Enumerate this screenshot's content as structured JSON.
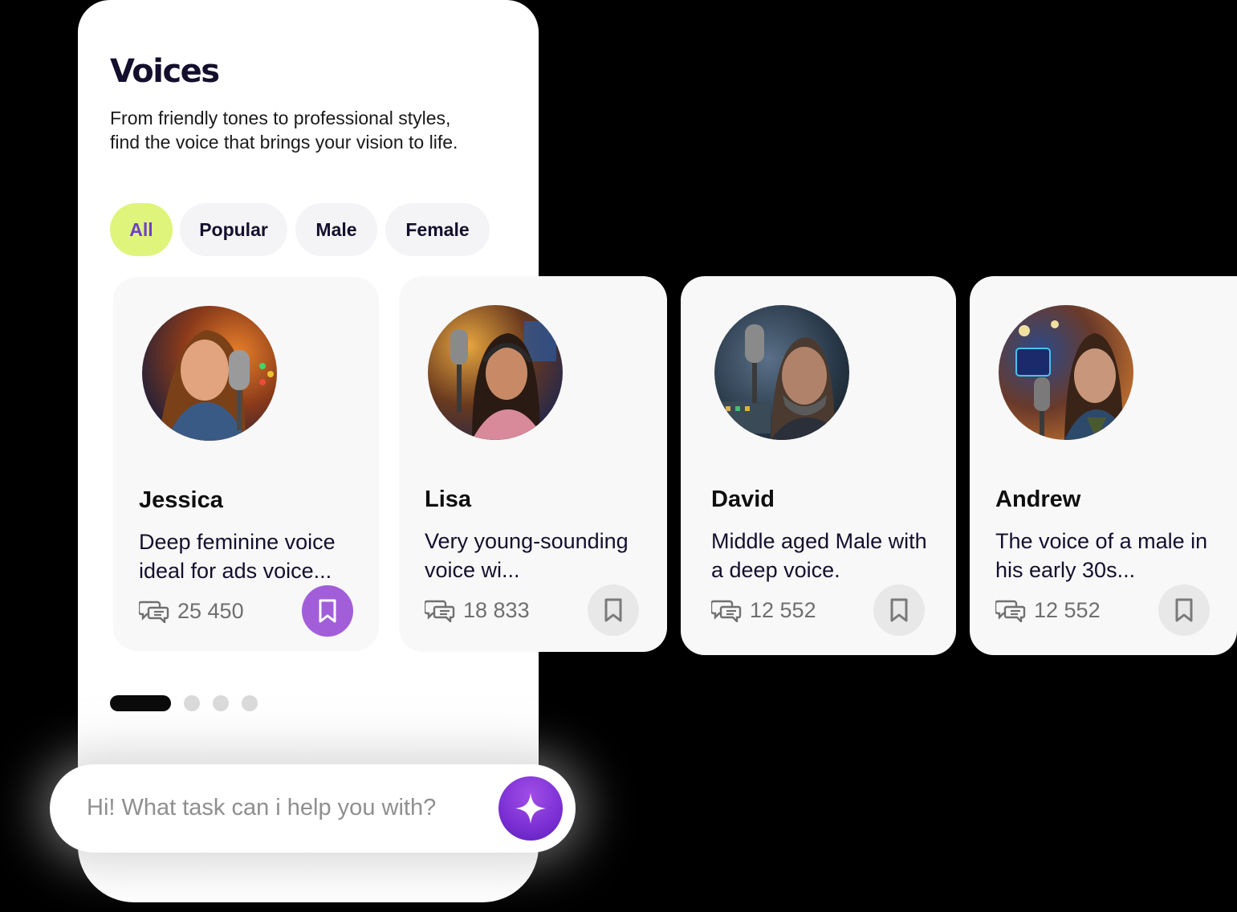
{
  "header": {
    "title": "Voices",
    "subtitle": "From friendly tones to professional styles, find the voice that brings your vision to life."
  },
  "filters": [
    {
      "label": "All",
      "active": true
    },
    {
      "label": "Popular",
      "active": false
    },
    {
      "label": "Male",
      "active": false
    },
    {
      "label": "Female",
      "active": false
    }
  ],
  "voices": [
    {
      "name": "Jessica",
      "description": "Deep feminine voice ideal for ads voice...",
      "count": "25 450",
      "bookmarked": true
    },
    {
      "name": "Lisa",
      "description": "Very young-sounding voice wi...",
      "count": "18 833",
      "bookmarked": false
    },
    {
      "name": "David",
      "description": "Middle aged Male with a deep voice.",
      "count": "12 552",
      "bookmarked": false
    },
    {
      "name": "Andrew",
      "description": "The voice of a male in his early 30s...",
      "count": "12 552",
      "bookmarked": false
    }
  ],
  "pagination": {
    "total": 4,
    "current": 1
  },
  "chat": {
    "placeholder": "Hi! What task can i help you with?",
    "button_icon": "sparkle-icon"
  },
  "icons": {
    "count": "chat-bubbles-icon",
    "bookmark": "bookmark-icon"
  },
  "colors": {
    "accent_purple": "#a25ed8",
    "active_chip_bg": "#dff47a",
    "active_chip_text": "#6e3fc5",
    "title_text": "#150f2e"
  }
}
